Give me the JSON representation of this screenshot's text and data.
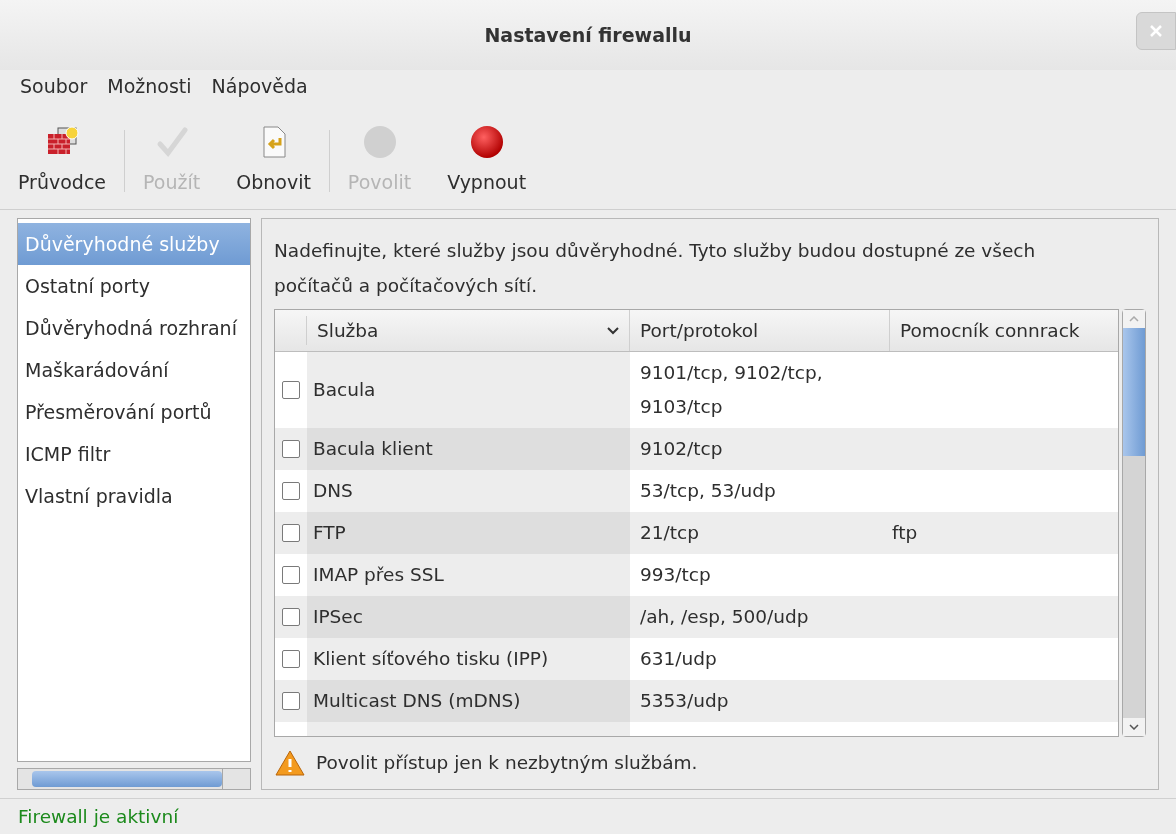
{
  "window": {
    "title": "Nastavení firewallu"
  },
  "menu": [
    "Soubor",
    "Možnosti",
    "Nápověda"
  ],
  "toolbar": [
    [
      {
        "label": "Průvodce",
        "disabled": false
      }
    ],
    [
      {
        "label": "Použít",
        "disabled": true
      },
      {
        "label": "Obnovit",
        "disabled": false
      }
    ],
    [
      {
        "label": "Povolit",
        "disabled": true
      },
      {
        "label": "Vypnout",
        "disabled": false
      }
    ]
  ],
  "sidebar": {
    "items": [
      {
        "label": "Důvěryhodné služby",
        "selected": true
      },
      {
        "label": "Ostatní porty",
        "selected": false
      },
      {
        "label": "Důvěryhodná rozhraní",
        "selected": false
      },
      {
        "label": "Maškarádování",
        "selected": false
      },
      {
        "label": "Přesměrování portů",
        "selected": false
      },
      {
        "label": "ICMP filtr",
        "selected": false
      },
      {
        "label": "Vlastní pravidla",
        "selected": false
      }
    ]
  },
  "description": "Nadefinujte, které služby jsou důvěryhodné. Tyto služby budou dostupné ze všech počítačů a počítačových sítí.",
  "table": {
    "columns": [
      "Služba",
      "Port/protokol",
      "Pomocník connrack"
    ],
    "rows": [
      {
        "service": "Bacula",
        "checked": false,
        "port": "9101/tcp, 9102/tcp, 9103/tcp",
        "helper": ""
      },
      {
        "service": "Bacula klient",
        "checked": false,
        "port": "9102/tcp",
        "helper": ""
      },
      {
        "service": "DNS",
        "checked": false,
        "port": "53/tcp, 53/udp",
        "helper": ""
      },
      {
        "service": "FTP",
        "checked": false,
        "port": "21/tcp",
        "helper": "ftp"
      },
      {
        "service": "IMAP přes SSL",
        "checked": false,
        "port": "993/tcp",
        "helper": ""
      },
      {
        "service": "IPSec",
        "checked": false,
        "port": "/ah, /esp, 500/udp",
        "helper": ""
      },
      {
        "service": "Klient síťového tisku (IPP)",
        "checked": false,
        "port": "631/udp",
        "helper": ""
      },
      {
        "service": "Multicast DNS (mDNS)",
        "checked": false,
        "port": "5353/udp",
        "helper": ""
      }
    ]
  },
  "warning": "Povolit přístup jen k nezbytným službám.",
  "status_bar": "Firewall je aktivní"
}
